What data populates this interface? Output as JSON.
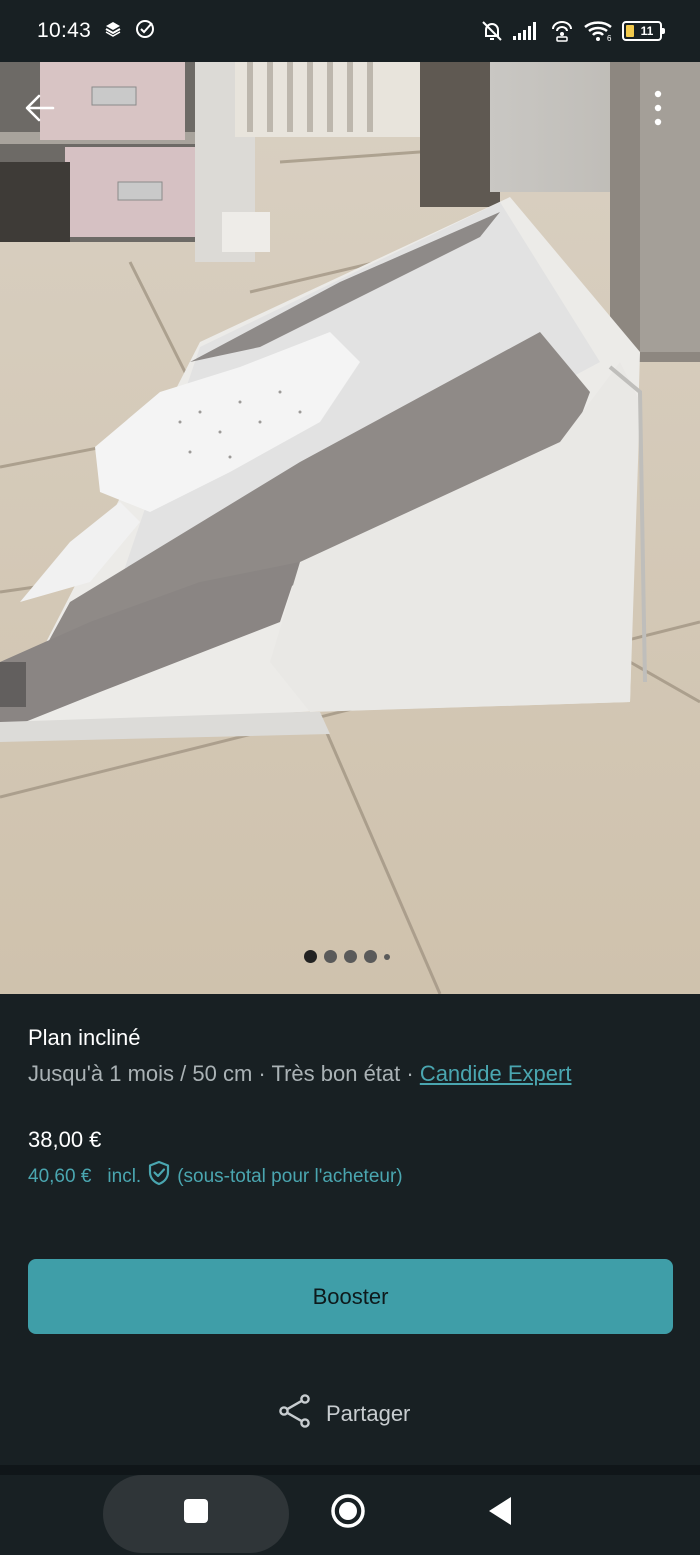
{
  "status_bar": {
    "time": "10:43",
    "battery_level": "11",
    "icons": [
      "layers-icon",
      "check-circle-icon",
      "bell-off-icon",
      "signal-icon",
      "hotspot-icon",
      "wifi-icon",
      "battery-icon"
    ]
  },
  "photo": {
    "icons": {
      "back": "arrow-left-icon",
      "more": "more-vertical-icon"
    },
    "carousel": {
      "count": 5,
      "active_index": 0
    }
  },
  "item": {
    "title": "Plan incliné",
    "subtitle_prefix": "Jusqu'à 1 mois / 50 cm · Très bon état · ",
    "brand": "Candide Expert",
    "price": "38,00 €",
    "total_price": "40,60 €",
    "total_incl": "incl.",
    "total_note": "(sous-total pour l'acheteur)"
  },
  "actions": {
    "booster_label": "Booster",
    "share_label": "Partager"
  },
  "colors": {
    "background": "#182023",
    "accent": "#3f9ea8",
    "link": "#4aa6b0",
    "muted_text": "#aab2b5"
  },
  "nav_bar": {
    "icons": [
      "recents-square-icon",
      "home-circle-icon",
      "back-triangle-icon"
    ]
  }
}
